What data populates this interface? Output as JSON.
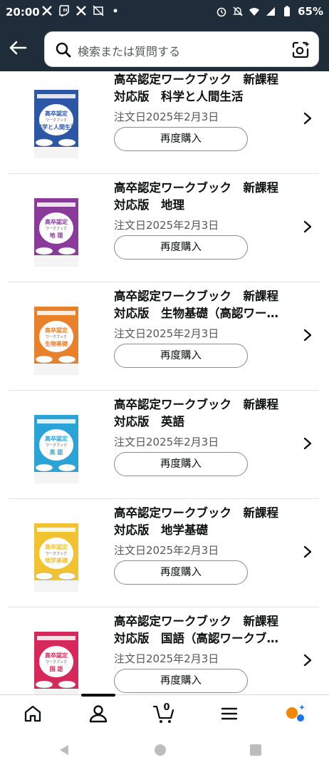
{
  "status_bar": {
    "time": "20:00",
    "battery": "65%",
    "left_icons": [
      "x-icon",
      "twitch-icon",
      "x-icon",
      "no-image-icon",
      "dot-icon"
    ],
    "right_icons": [
      "alarm-icon",
      "mute-icon",
      "wifi-icon",
      "signal-icon",
      "battery-icon"
    ]
  },
  "header": {
    "search_placeholder": "検索または質問する"
  },
  "orders": [
    {
      "title_line1": "高卒認定ワークブック　新課程",
      "title_line2": "対応版　科学と人間生活",
      "date": "注文日2025年2月3日",
      "button": "再度購入",
      "cover_color": "#2b57a6",
      "cover_subject": "科学と人間生活"
    },
    {
      "title_line1": "高卒認定ワークブック　新課程",
      "title_line2": "対応版　地理",
      "date": "注文日2025年2月3日",
      "button": "再度購入",
      "cover_color": "#8a3a9a",
      "cover_subject": "地 理"
    },
    {
      "title_line1": "高卒認定ワークブック　新課程",
      "title_line2": "対応版　生物基礎（高認ワー…",
      "date": "注文日2025年2月3日",
      "button": "再度購入",
      "cover_color": "#e8812a",
      "cover_subject": "生物基礎"
    },
    {
      "title_line1": "高卒認定ワークブック　新課程",
      "title_line2": "対応版　英語",
      "date": "注文日2025年2月3日",
      "button": "再度購入",
      "cover_color": "#2aa3d6",
      "cover_subject": "英 語"
    },
    {
      "title_line1": "高卒認定ワークブック　新課程",
      "title_line2": "対応版　地学基礎",
      "date": "注文日2025年2月3日",
      "button": "再度購入",
      "cover_color": "#f2c230",
      "cover_subject": "地学基礎"
    },
    {
      "title_line1": "高卒認定ワークブック　新課程",
      "title_line2": "対応版　国語（高認ワークブ…",
      "date": "注文日2025年2月3日",
      "button": "再度購入",
      "cover_color": "#d6285a",
      "cover_subject": "国 語"
    }
  ],
  "cover_text": {
    "title": "高卒認定",
    "sub": "ワークブック"
  },
  "bottom_nav": {
    "cart_count": "0",
    "items": [
      "home-icon",
      "account-icon",
      "cart-icon",
      "menu-icon",
      "rufus-icon"
    ]
  },
  "colors": {
    "header_bg": "#1f2d3a",
    "accent_orange": "#f08804",
    "accent_blue": "#1a73e8"
  }
}
